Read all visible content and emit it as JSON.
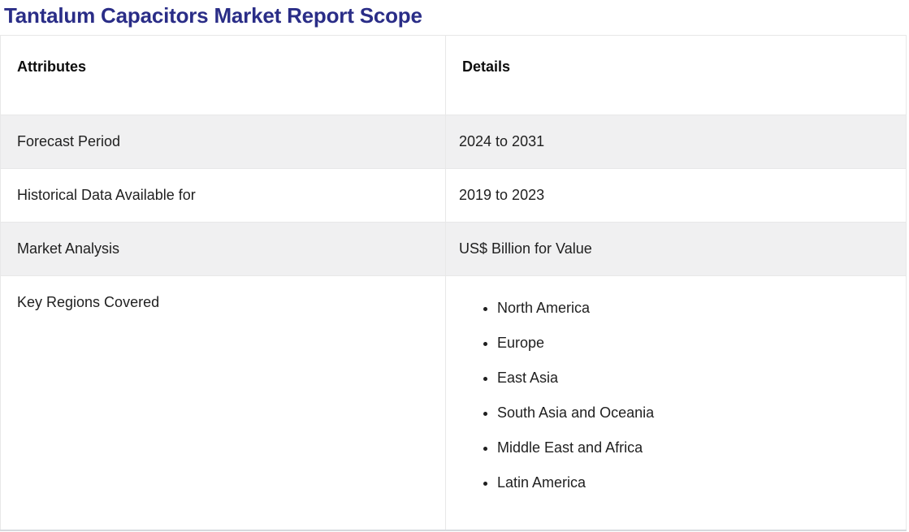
{
  "page": {
    "title": "Tantalum Capacitors Market Report Scope"
  },
  "table": {
    "headers": [
      "Attributes",
      "Details"
    ],
    "rows": [
      {
        "attribute": "Forecast Period",
        "detail": "2024 to 2031"
      },
      {
        "attribute": "Historical Data Available for",
        "detail": "2019 to 2023"
      },
      {
        "attribute": "Market Analysis",
        "detail": "US$ Billion for Value"
      },
      {
        "attribute": "Key Regions Covered",
        "detail_list": [
          "North America",
          "Europe",
          "East Asia",
          "South Asia and Oceania",
          "Middle East and Africa",
          "Latin America"
        ]
      }
    ]
  },
  "colors": {
    "title": "#2a2d87",
    "row_shaded": "#f0f0f1",
    "border": "#e8e8e8",
    "bottom_border": "#d6d9de"
  }
}
